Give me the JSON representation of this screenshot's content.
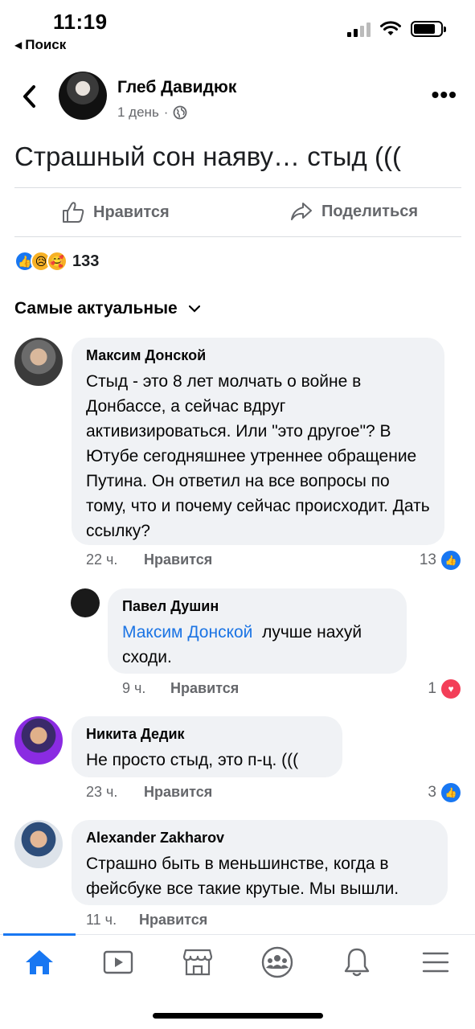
{
  "status_bar": {
    "time": "11:19",
    "back_app": "Поиск"
  },
  "post": {
    "author": "Глеб Давидюк",
    "age": "1 день",
    "text": "Страшный сон наяву… стыд (((",
    "like_label": "Нравится",
    "share_label": "Поделиться",
    "reactions": [
      "like",
      "sad",
      "care"
    ],
    "reaction_count": "133"
  },
  "sort_label": "Самые актуальные",
  "comments": [
    {
      "name": "Максим Донской",
      "text": "Стыд - это 8 лет молчать о войне в Донбассе, а сейчас вдруг активизироваться. Или \"это другое\"? В Ютубе сегодняшнее утреннее обращение Путина. Он ответил на все вопросы по тому, что и почему сейчас происходит. Дать ссылку?",
      "time": "22 ч.",
      "like_label": "Нравится",
      "reaction_count": "13",
      "reaction": "like"
    },
    {
      "name": "Павел Душин",
      "mention": "Максим Донской",
      "text": "лучше нахуй сходи.",
      "time": "9 ч.",
      "like_label": "Нравится",
      "reaction_count": "1",
      "reaction": "love"
    },
    {
      "name": "Никита Дедик",
      "text": "Не просто стыд, это п-ц. (((",
      "time": "23 ч.",
      "like_label": "Нравится",
      "reaction_count": "3",
      "reaction": "like"
    },
    {
      "name": "Alexander Zakharov",
      "text": "Страшно быть в меньшинстве, когда в фейсбуке все такие крутые. Мы вышли.",
      "time": "11 ч.",
      "like_label": "Нравится"
    }
  ],
  "tabs": [
    "home-icon",
    "video-icon",
    "marketplace-icon",
    "groups-icon",
    "notifications-icon",
    "menu-icon"
  ],
  "colors": {
    "accent": "#1877f2",
    "bubble": "#f0f2f5",
    "meta": "#65676b"
  }
}
